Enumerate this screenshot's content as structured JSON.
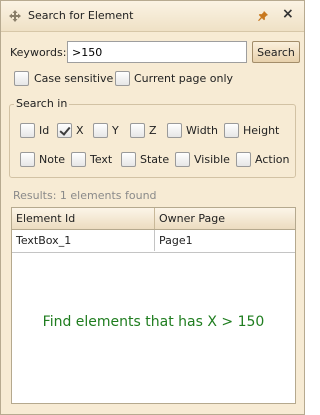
{
  "window": {
    "title": "Search for Element",
    "title_icon": "move-icon",
    "pin_icon": "pin-icon",
    "close_icon": "close-icon"
  },
  "search": {
    "keywords_label": "Keywords:",
    "keywords_value": ">150",
    "search_button": "Search"
  },
  "options": {
    "case_sensitive": {
      "label": "Case sensitive",
      "checked": false
    },
    "current_page_only": {
      "label": "Current page only",
      "checked": false
    }
  },
  "search_in": {
    "title": "Search in",
    "fields": [
      {
        "label": "Id",
        "checked": false
      },
      {
        "label": "X",
        "checked": true
      },
      {
        "label": "Y",
        "checked": false
      },
      {
        "label": "Z",
        "checked": false
      },
      {
        "label": "Width",
        "checked": false
      },
      {
        "label": "Height",
        "checked": false
      },
      {
        "label": "Note",
        "checked": false
      },
      {
        "label": "Text",
        "checked": false
      },
      {
        "label": "State",
        "checked": false
      },
      {
        "label": "Visible",
        "checked": false
      },
      {
        "label": "Action",
        "checked": false
      }
    ]
  },
  "results": {
    "summary": "Results: 1 elements found",
    "columns": [
      "Element Id",
      "Owner Page"
    ],
    "rows": [
      [
        "TextBox_1",
        "Page1"
      ]
    ]
  },
  "annotation": "Find elements that has X > 150",
  "colors": {
    "panel_background": "#f7ebd4",
    "annotation_text": "#1f7d1f"
  }
}
